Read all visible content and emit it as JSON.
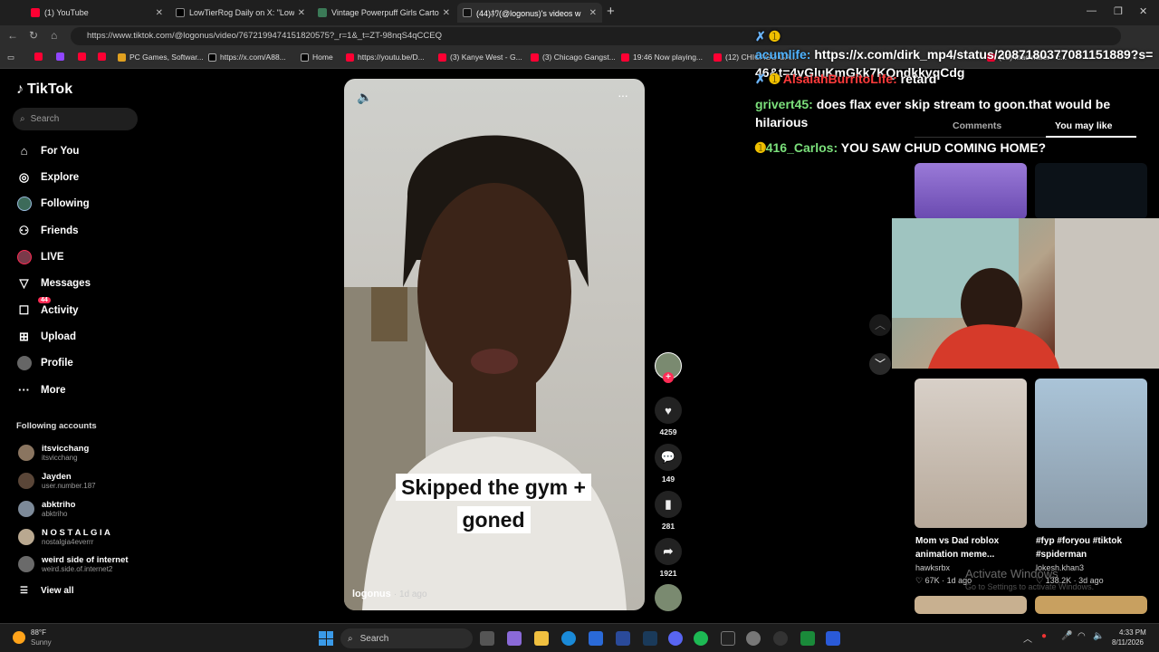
{
  "browser": {
    "tabs": [
      {
        "title": "(1) YouTube",
        "color": "#ff0033"
      },
      {
        "title": "LowTierRog Daily on X: \"LowTierG",
        "color": "#000000"
      },
      {
        "title": "Vintage Powerpuff Girls Cartoon N",
        "color": "#3b7a57"
      },
      {
        "title": "(44)ﾎﾜ(@logonus)'s videos w",
        "color": "#111111"
      }
    ],
    "url": "https://www.tiktok.com/@logonus/video/7672199474151820575?_r=1&_t=ZT-98nqS4qCCEQ",
    "bookmarks": [
      {
        "label": "PC Games, Softwar...",
        "color": "#e0a020"
      },
      {
        "label": "https://x.com/A88...",
        "color": "#000000"
      },
      {
        "label": "Home",
        "color": "#000000"
      },
      {
        "label": "https://youtu.be/D...",
        "color": "#ff0033"
      },
      {
        "label": "(3) Kanye West - G...",
        "color": "#ff0033"
      },
      {
        "label": "(3) Chicago Gangst...",
        "color": "#ff0033"
      },
      {
        "label": "19:46 Now playing...",
        "color": "#ff0033"
      },
      {
        "label": "(12) CHICAGO GA...",
        "color": "#ff0033"
      },
      {
        "label": "(15) mac miller - c...",
        "color": "#ff0033"
      }
    ]
  },
  "tiktok": {
    "logo": "TikTok",
    "search_placeholder": "Search",
    "nav": [
      {
        "label": "For You",
        "icon": "home-icon",
        "glyph": "⌂"
      },
      {
        "label": "Explore",
        "icon": "compass-icon",
        "glyph": "◎"
      },
      {
        "label": "Following",
        "icon": "avatar-icon",
        "glyph": "●"
      },
      {
        "label": "Friends",
        "icon": "friends-icon",
        "glyph": "👥"
      },
      {
        "label": "LIVE",
        "icon": "live-icon",
        "glyph": "●"
      },
      {
        "label": "Messages",
        "icon": "messages-icon",
        "glyph": "▽"
      },
      {
        "label": "Activity",
        "icon": "activity-icon",
        "glyph": "☐",
        "badge": "44"
      },
      {
        "label": "Upload",
        "icon": "upload-icon",
        "glyph": "⊞"
      },
      {
        "label": "Profile",
        "icon": "profile-icon",
        "glyph": "●"
      },
      {
        "label": "More",
        "icon": "more-icon",
        "glyph": "···"
      }
    ],
    "following_title": "Following accounts",
    "accounts": [
      {
        "name": "itsvicchang",
        "handle": "itsvicchang"
      },
      {
        "name": "Jayden",
        "handle": "user.number.187"
      },
      {
        "name": "abktriho",
        "handle": "abktriho"
      },
      {
        "name": "N O S T A L G I A",
        "handle": "nostalgia4everrr"
      },
      {
        "name": "weird side of internet",
        "handle": "weird.side.of.internet2"
      }
    ],
    "view_all": "View all",
    "video": {
      "caption": "Skipped the gym + goned",
      "author": "logonus",
      "ago": "· 1d ago",
      "likes": "4259",
      "comments": "149",
      "saves": "281",
      "shares": "1921"
    },
    "right_tabs": [
      "Comments",
      "You may like"
    ],
    "cards": [
      {
        "title": "Mom vs Dad roblox animation meme...",
        "user": "hawksrbx",
        "likes": "♡ 67K · 1d ago"
      },
      {
        "title": "#fyp #foryou #tiktok #spiderman",
        "user": "lokesh.khan3",
        "likes": "♡ 138.2K · 3d ago"
      }
    ]
  },
  "chat": [
    {
      "user": "acumlife:",
      "msg": "https://x.com/dirk_mp4/status/2087180377081151889?s=46&t=4vGluKmGkk7KQndkkvqCdg",
      "color": "#4fb3ff"
    },
    {
      "user": "AlsaiahBurritoLife:",
      "msg": "retard",
      "color": "#ff3b3b"
    },
    {
      "user": "grivert45:",
      "msg": "does flax ever skip stream to goon.that would be hilarious",
      "color": "#7be07b"
    },
    {
      "user": "416_Carlos:",
      "msg": "YOU SAW CHUD COMING HOME?",
      "color": "#7be07b"
    }
  ],
  "windows_watermark": {
    "line1": "Activate Windows",
    "line2": "Go to Settings to activate Windows."
  },
  "taskbar": {
    "weather_temp": "88°F",
    "weather_text": "Sunny",
    "search": "Search",
    "time": "4:33 PM",
    "date": "8/11/2026"
  }
}
